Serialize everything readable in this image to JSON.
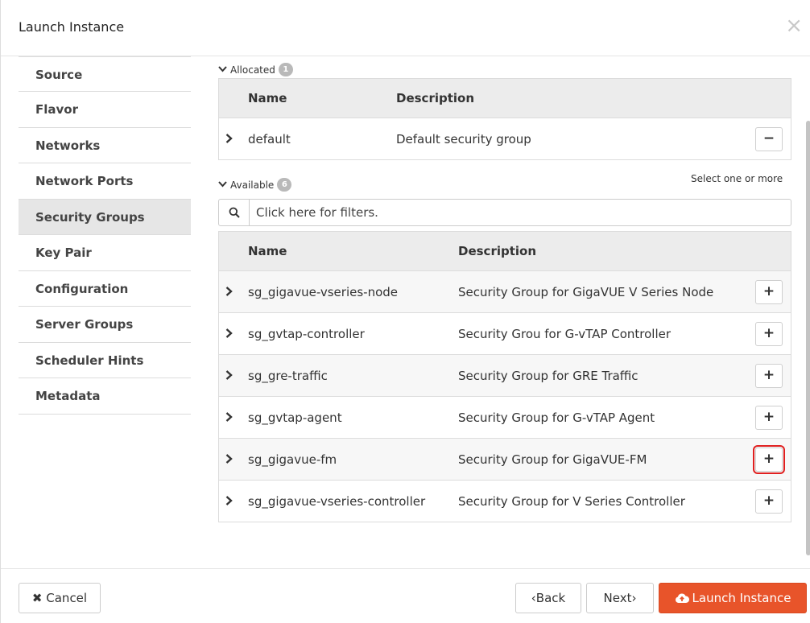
{
  "modal": {
    "title": "Launch Instance",
    "close_glyph": "×"
  },
  "sidebar": {
    "items": [
      {
        "label": "Source"
      },
      {
        "label": "Flavor"
      },
      {
        "label": "Networks"
      },
      {
        "label": "Network Ports"
      },
      {
        "label": "Security Groups",
        "active": true
      },
      {
        "label": "Key Pair"
      },
      {
        "label": "Configuration"
      },
      {
        "label": "Server Groups"
      },
      {
        "label": "Scheduler Hints"
      },
      {
        "label": "Metadata"
      }
    ]
  },
  "allocated": {
    "label": "Allocated",
    "count": "1",
    "columns": [
      "Name",
      "Description"
    ],
    "rows": [
      {
        "name": "default",
        "description": "Default security group",
        "action": "−"
      }
    ]
  },
  "available": {
    "label": "Available",
    "count": "6",
    "hint": "Select one or more",
    "filter_placeholder": "Click here for filters.",
    "columns": [
      "Name",
      "Description"
    ],
    "rows": [
      {
        "name": "sg_gigavue-vseries-node",
        "description": "Security Group for GigaVUE V Series Node",
        "action": "+"
      },
      {
        "name": "sg_gvtap-controller",
        "description": "Security Grou for G-vTAP Controller",
        "action": "+"
      },
      {
        "name": "sg_gre-traffic",
        "description": "Security Group for GRE Traffic",
        "action": "+"
      },
      {
        "name": "sg_gvtap-agent",
        "description": "Security Group for G-vTAP Agent",
        "action": "+"
      },
      {
        "name": "sg_gigavue-fm",
        "description": "Security Group for GigaVUE-FM",
        "action": "+",
        "highlighted": true
      },
      {
        "name": "sg_gigavue-vseries-controller",
        "description": "Security Group for V Series Controller",
        "action": "+"
      }
    ]
  },
  "footer": {
    "cancel_label": "Cancel",
    "back_label": "Back",
    "next_label": "Next",
    "launch_label": "Launch Instance"
  },
  "icons": {
    "caret": "›",
    "chevron_down": "chevron-down-icon",
    "search": "search-icon",
    "cloud_upload": "cloud-upload-icon",
    "close": "close-icon"
  },
  "colors": {
    "primary": "#e8542a",
    "active_sidebar": "#e6e6e6",
    "highlight_border": "#e02020"
  }
}
